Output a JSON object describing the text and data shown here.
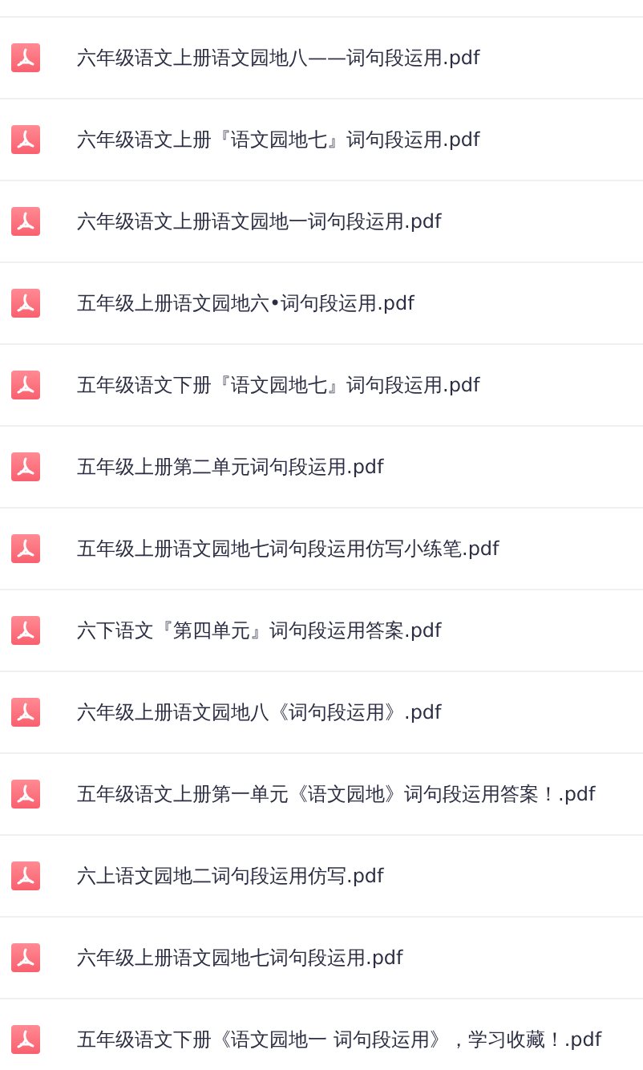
{
  "files": [
    {
      "name": "六年级语文上册语文园地八——词句段运用.pdf"
    },
    {
      "name": "六年级语文上册『语文园地七』词句段运用.pdf"
    },
    {
      "name": "六年级语文上册语文园地一词句段运用.pdf"
    },
    {
      "name": "五年级上册语文园地六•词句段运用.pdf"
    },
    {
      "name": "五年级语文下册『语文园地七』词句段运用.pdf"
    },
    {
      "name": "五年级上册第二单元词句段运用.pdf"
    },
    {
      "name": "五年级上册语文园地七词句段运用仿写小练笔.pdf"
    },
    {
      "name": "六下语文『第四单元』词句段运用答案.pdf"
    },
    {
      "name": "六年级上册语文园地八《词句段运用》.pdf"
    },
    {
      "name": "五年级语文上册第一单元《语文园地》词句段运用答案！.pdf"
    },
    {
      "name": "六上语文园地二词句段运用仿写.pdf"
    },
    {
      "name": "六年级上册语文园地七词句段运用.pdf"
    },
    {
      "name": "五年级语文下册《语文园地一 词句段运用》，学习收藏！.pdf"
    }
  ]
}
